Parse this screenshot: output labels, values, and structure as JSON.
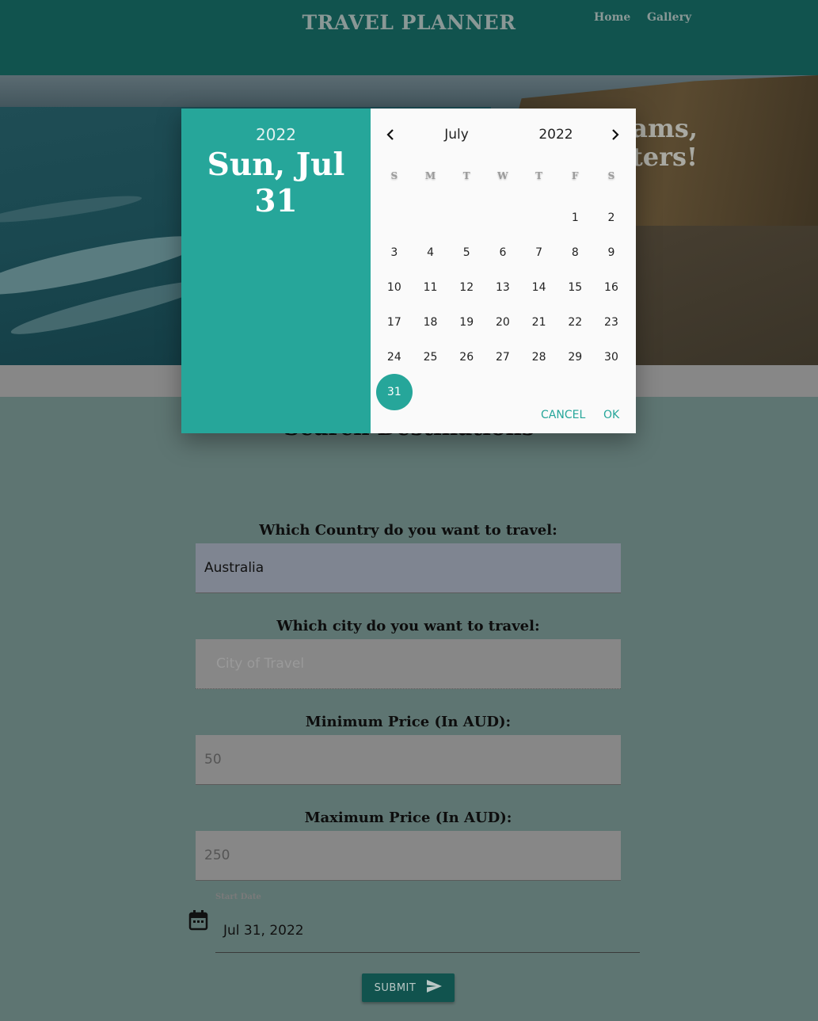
{
  "header": {
    "title": "TRAVEL PLANNER",
    "nav": [
      {
        "label": "Home"
      },
      {
        "label": "Gallery"
      }
    ]
  },
  "hero": {
    "line1": "eams,",
    "line2": "tters!"
  },
  "search": {
    "title": "Search Destinations",
    "country_label": "Which Country do you want to travel:",
    "country_value": "Australia",
    "city_label": "Which city do you want to travel:",
    "city_placeholder": "City of Travel",
    "min_label": "Minimum Price (In AUD):",
    "min_value": "50",
    "max_label": "Maximum Price (In AUD):",
    "max_value": "250",
    "start_date_label": "Start Date",
    "start_date_value": "Jul 31, 2022",
    "submit_label": "SUBMIT"
  },
  "date_picker": {
    "year": "2022",
    "selected_display": "Sun, Jul 31",
    "month": "July",
    "nav_year": "2022",
    "weekdays": [
      "S",
      "M",
      "T",
      "W",
      "T",
      "F",
      "S"
    ],
    "leading_blanks": 5,
    "days": [
      "1",
      "2",
      "3",
      "4",
      "5",
      "6",
      "7",
      "8",
      "9",
      "10",
      "11",
      "12",
      "13",
      "14",
      "15",
      "16",
      "17",
      "18",
      "19",
      "20",
      "21",
      "22",
      "23",
      "24",
      "25",
      "26",
      "27",
      "28",
      "29",
      "30",
      "31"
    ],
    "selected_day": "31",
    "cancel_label": "CANCEL",
    "ok_label": "OK",
    "accent_color": "#26a69a"
  },
  "icons": {
    "prev": "chevron-left-icon",
    "next": "chevron-right-icon",
    "calendar": "calendar-icon",
    "send": "send-icon"
  }
}
